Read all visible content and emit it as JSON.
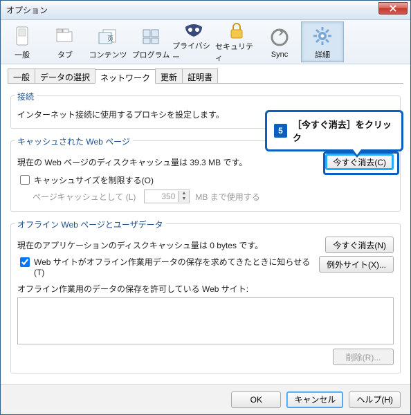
{
  "window": {
    "title": "オプション"
  },
  "toolbar": [
    {
      "key": "general",
      "label": "一般"
    },
    {
      "key": "tabs",
      "label": "タブ"
    },
    {
      "key": "content",
      "label": "コンテンツ"
    },
    {
      "key": "apps",
      "label": "プログラム"
    },
    {
      "key": "privacy",
      "label": "プライバシー"
    },
    {
      "key": "security",
      "label": "セキュリティ"
    },
    {
      "key": "sync",
      "label": "Sync"
    },
    {
      "key": "advanced",
      "label": "詳細",
      "selected": true
    }
  ],
  "subtabs": [
    {
      "label": "一般"
    },
    {
      "label": "データの選択"
    },
    {
      "label": "ネットワーク",
      "active": true
    },
    {
      "label": "更新"
    },
    {
      "label": "証明書"
    }
  ],
  "conn": {
    "title": "接続",
    "desc": "インターネット接続に使用するプロキシを設定します。"
  },
  "cache": {
    "title": "キャッシュされた Web ページ",
    "desc": "現在の Web ページのディスクキャッシュ量は 39.3 MB です。",
    "clear_btn": "今すぐ消去(C)",
    "limit_label": "キャッシュサイズを制限する(O)",
    "pagecache_label": "ページキャッシュとして (L)",
    "pagecache_value": "350",
    "pagecache_suffix": "MB まで使用する"
  },
  "offline": {
    "title": "オフライン Web ページとユーザデータ",
    "desc": "現在のアプリケーションのディスクキャッシュ量は 0 bytes です。",
    "clear_btn": "今すぐ消去(N)",
    "notify_label": "Web サイトがオフライン作業用データの保存を求めてきたときに知らせる(T)",
    "exceptions_btn": "例外サイト(X)...",
    "allowed_label": "オフライン作業用のデータの保存を許可している Web サイト:",
    "remove_btn": "削除(R)..."
  },
  "footer": {
    "ok": "OK",
    "cancel": "キャンセル",
    "help": "ヘルプ(H)"
  },
  "callout": {
    "num": "5",
    "text": "［今すぐ消去］をクリック"
  }
}
